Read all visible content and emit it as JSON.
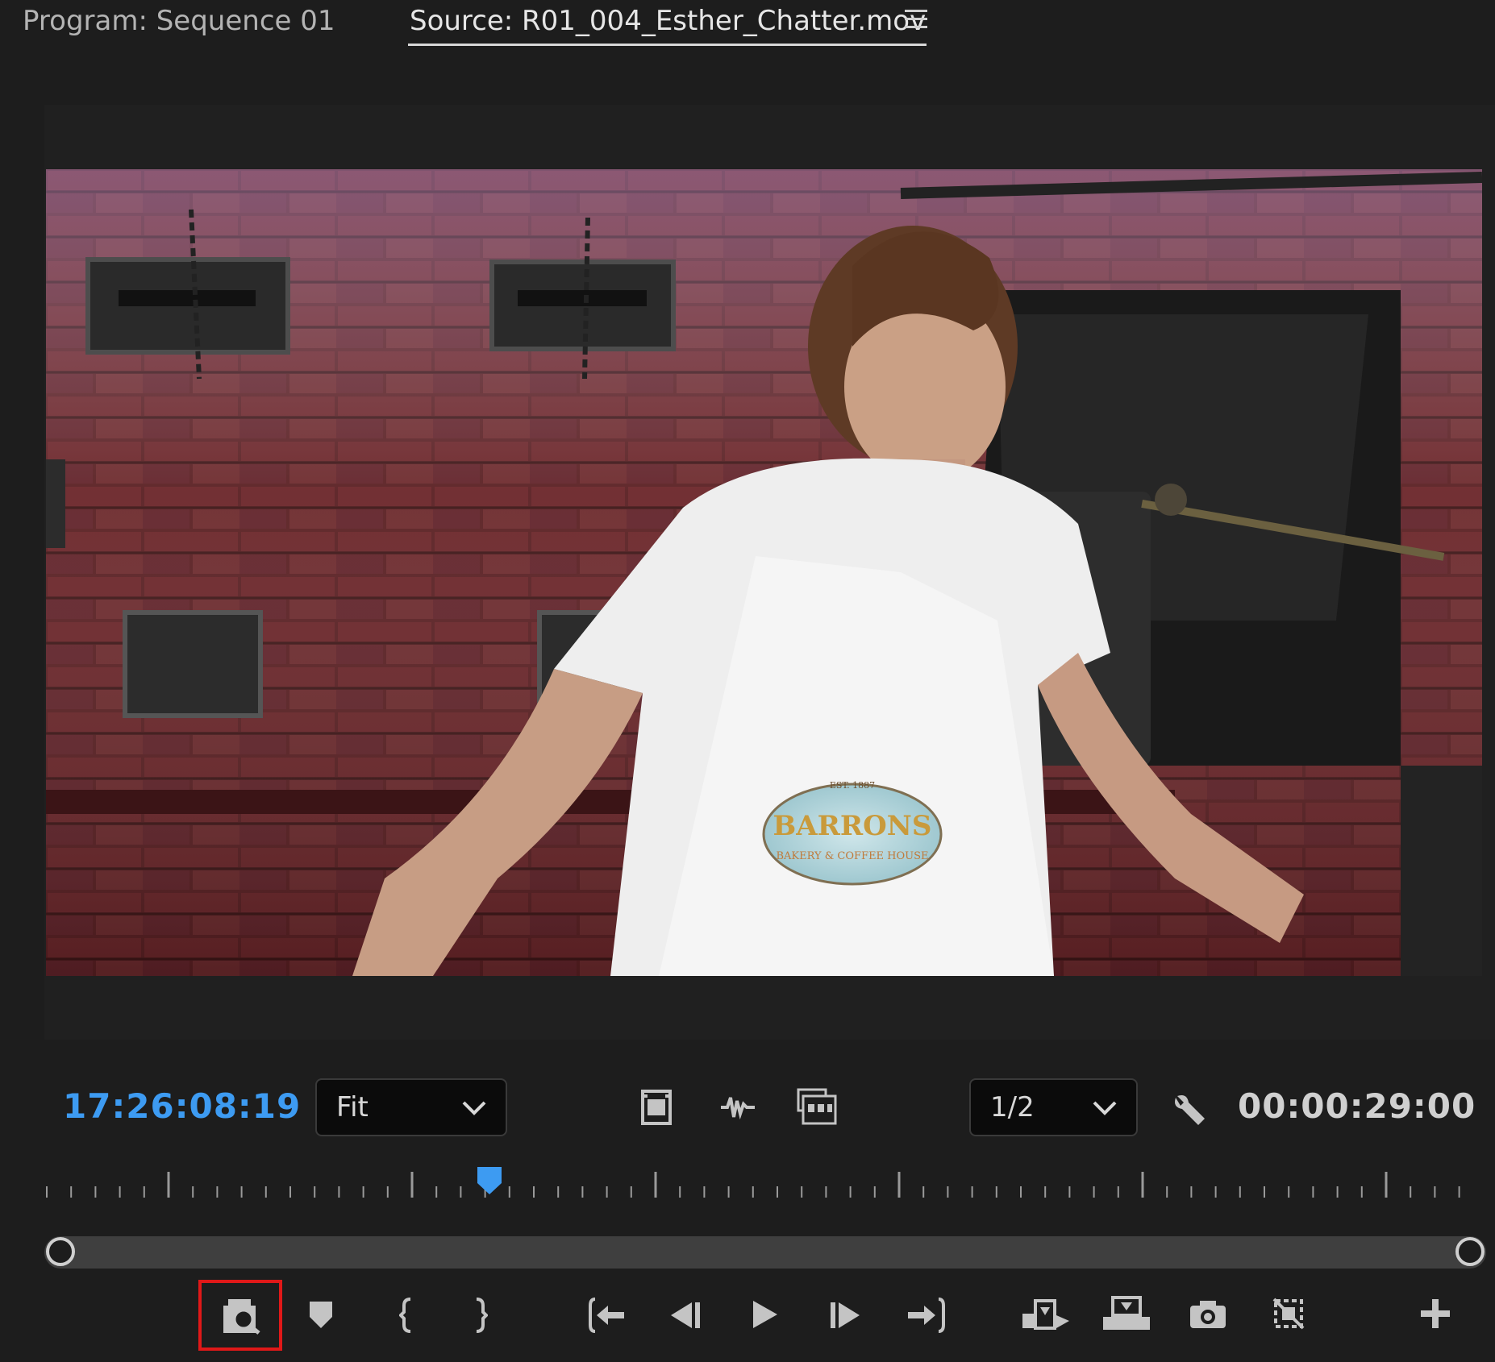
{
  "tabs": {
    "program_label": "Program: Sequence 01",
    "source_label": "Source: R01_004_Esther_Chatter.mov"
  },
  "timecode": {
    "playhead": "17:26:08:19",
    "duration": "00:00:29:00"
  },
  "zoom": {
    "selected": "Fit"
  },
  "resolution": {
    "selected": "1/2"
  },
  "video": {
    "apron_text_top": "EST. 1887",
    "apron_text_main": "BARRONS",
    "apron_text_sub": "BAKERY & COFFEE HOUSE"
  },
  "transport": {
    "icons": [
      "filter-search-icon",
      "marker-icon",
      "mark-in-icon",
      "mark-out-icon",
      "go-to-in-icon",
      "step-back-icon",
      "play-icon",
      "step-forward-icon",
      "go-to-out-icon",
      "insert-icon",
      "overwrite-icon",
      "export-frame-icon",
      "proxy-toggle-icon",
      "add-button-icon"
    ]
  },
  "colors": {
    "timecode_blue": "#3d9bf2",
    "highlight_red": "#e01818",
    "panel_bg": "#1d1d1d"
  }
}
